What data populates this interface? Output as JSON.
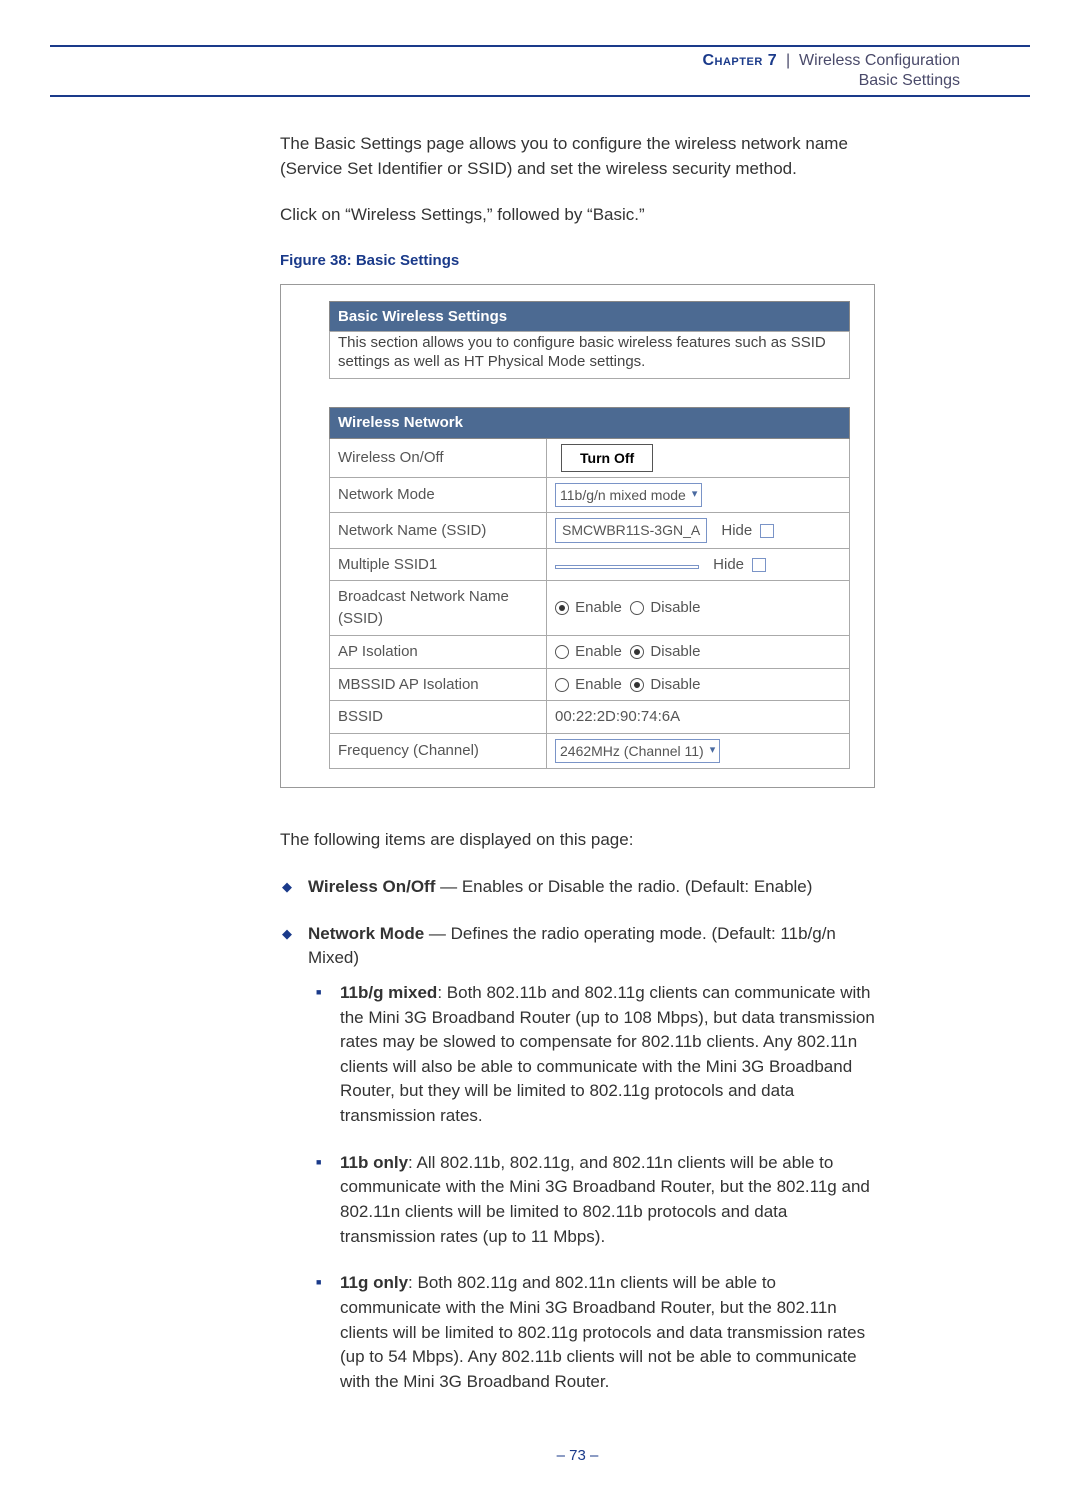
{
  "header": {
    "chapter_label": "Chapter 7",
    "separator": "|",
    "section": "Wireless Configuration",
    "subsection": "Basic Settings"
  },
  "intro": {
    "p1": "The Basic Settings page allows you to configure the wireless network name (Service Set Identifier or SSID) and set the wireless security method.",
    "p2": "Click on “Wireless Settings,” followed by “Basic.”"
  },
  "figure": {
    "caption": "Figure 38:  Basic Settings",
    "panel_title": "Basic Wireless Settings",
    "panel_desc": "This section allows you to configure basic wireless features such as SSID settings as well as HT Physical Mode settings.",
    "section_header": "Wireless Network",
    "rows": {
      "wireless_onoff": {
        "label": "Wireless On/Off",
        "button": "Turn Off"
      },
      "network_mode": {
        "label": "Network Mode",
        "value": "11b/g/n mixed mode"
      },
      "ssid": {
        "label": "Network Name (SSID)",
        "value": "SMCWBR11S-3GN_A",
        "hide": "Hide"
      },
      "mssid1": {
        "label": "Multiple SSID1",
        "value": "",
        "hide": "Hide"
      },
      "broadcast": {
        "label": "Broadcast Network Name (SSID)",
        "enable": "Enable",
        "disable": "Disable",
        "selected": "enable"
      },
      "ap_iso": {
        "label": "AP Isolation",
        "enable": "Enable",
        "disable": "Disable",
        "selected": "disable"
      },
      "mbssid_iso": {
        "label": "MBSSID AP Isolation",
        "enable": "Enable",
        "disable": "Disable",
        "selected": "disable"
      },
      "bssid": {
        "label": "BSSID",
        "value": "00:22:2D:90:74:6A"
      },
      "freq": {
        "label": "Frequency (Channel)",
        "value": "2462MHz (Channel 11)"
      }
    }
  },
  "body": {
    "lead": "The following items are displayed on this page:",
    "items": [
      {
        "term": "Wireless On/Off",
        "desc": " — Enables or Disable the radio. (Default: Enable)"
      },
      {
        "term": "Network Mode",
        "desc": " — Defines the radio operating mode. (Default: 11b/g/n Mixed)",
        "sub": [
          {
            "term": "11b/g mixed",
            "desc": ": Both 802.11b and 802.11g clients can communicate with the Mini 3G Broadband Router (up to 108 Mbps), but data transmission rates may be slowed to compensate for 802.11b clients. Any 802.11n clients will also be able to communicate with the Mini 3G Broadband Router, but they will be limited to 802.11g protocols and data transmission rates."
          },
          {
            "term": "11b only",
            "desc": ": All 802.11b, 802.11g, and 802.11n clients will be able to communicate with the Mini 3G Broadband Router, but the 802.11g and 802.11n clients will be limited to 802.11b protocols and data transmission rates (up to 11 Mbps)."
          },
          {
            "term": "11g only",
            "desc": ": Both 802.11g and 802.11n clients will be able to communicate with the Mini 3G Broadband Router, but the 802.11n clients will be limited to 802.11g protocols and data transmission rates (up to 54 Mbps). Any 802.11b clients will not be able to communicate with the Mini 3G Broadband Router."
          }
        ]
      }
    ]
  },
  "page_number": "–  73  –"
}
